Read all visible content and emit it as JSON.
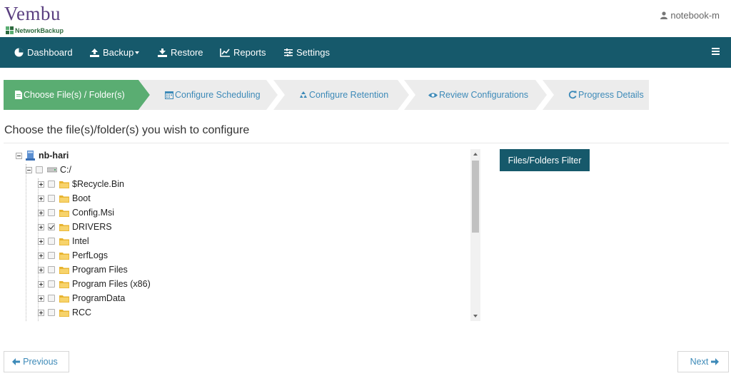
{
  "brand": {
    "name_initial": "V",
    "name_rest": "embu",
    "subtitle": "NetworkBackup",
    "accent": "#5a3f80",
    "sub_color": "#2d6a3e"
  },
  "user": {
    "name": "notebook-m",
    "icon": "user-icon"
  },
  "nav": {
    "bg": "#16596b",
    "items": [
      {
        "label": "Dashboard",
        "icon": "dashboard-icon"
      },
      {
        "label": "Backup",
        "icon": "upload-icon",
        "has_caret": true
      },
      {
        "label": "Restore",
        "icon": "download-icon"
      },
      {
        "label": "Reports",
        "icon": "chart-icon"
      },
      {
        "label": "Settings",
        "icon": "sliders-icon"
      }
    ],
    "menu_icon": "hamburger-icon"
  },
  "steps": [
    {
      "label": "Choose File(s) / Folder(s)",
      "icon": "file-icon",
      "active": true
    },
    {
      "label": "Configure Scheduling",
      "icon": "calendar-icon",
      "active": false
    },
    {
      "label": "Configure Retention",
      "icon": "recycle-icon",
      "active": false
    },
    {
      "label": "Review Configurations",
      "icon": "eye-icon",
      "active": false
    },
    {
      "label": "Progress Details",
      "icon": "refresh-icon",
      "active": false
    }
  ],
  "section_title": "Choose the file(s)/folder(s) you wish to configure",
  "tree": {
    "root": {
      "label": "nb-hari",
      "icon": "computer-icon"
    },
    "drive": {
      "label": "C:/",
      "icon": "drive-icon"
    },
    "folders": [
      {
        "label": "$Recycle.Bin",
        "checked": false
      },
      {
        "label": "Boot",
        "checked": false
      },
      {
        "label": "Config.Msi",
        "checked": false
      },
      {
        "label": "DRIVERS",
        "checked": true
      },
      {
        "label": "Intel",
        "checked": false
      },
      {
        "label": "PerfLogs",
        "checked": false
      },
      {
        "label": "Program Files",
        "checked": false
      },
      {
        "label": "Program Files (x86)",
        "checked": false
      },
      {
        "label": "ProgramData",
        "checked": false
      },
      {
        "label": "RCC",
        "checked": false
      }
    ]
  },
  "filter_button": "Files/Folders Filter",
  "buttons": {
    "previous": "Previous",
    "next": "Next"
  },
  "colors": {
    "step_active": "#5aad72",
    "step_inactive": "#ececec",
    "link": "#3d8ab8"
  }
}
